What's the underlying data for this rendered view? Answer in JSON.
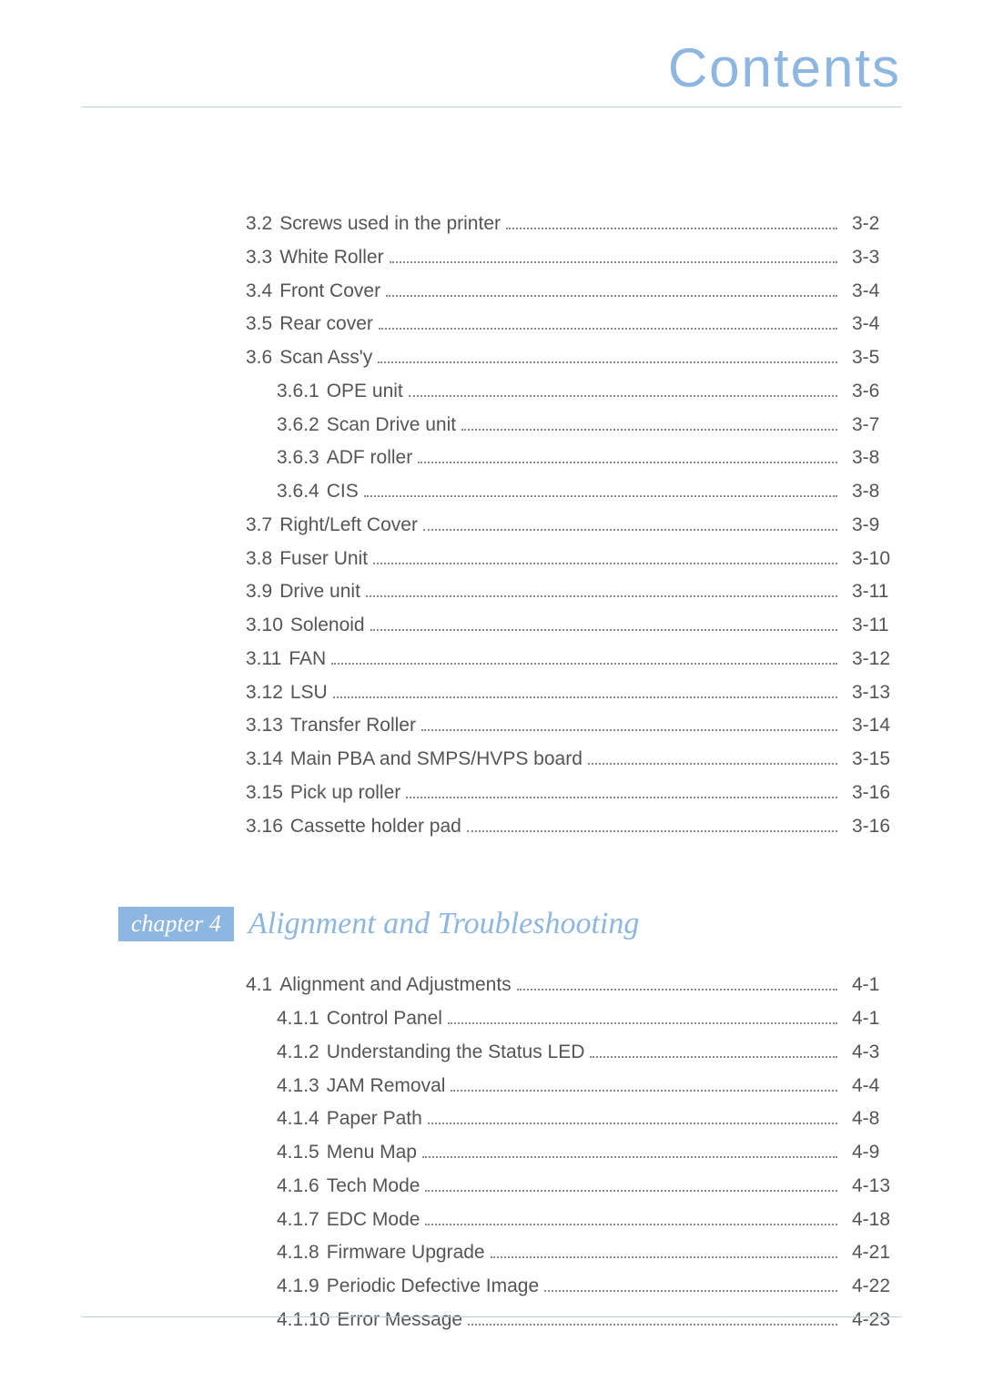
{
  "header": {
    "title": "Contents"
  },
  "section3": {
    "entries": [
      {
        "num": "3.2",
        "title": "Screws used in the printer",
        "page": "3-2",
        "indent": 0
      },
      {
        "num": "3.3",
        "title": "White Roller",
        "page": "3-3",
        "indent": 0
      },
      {
        "num": "3.4",
        "title": "Front Cover",
        "page": "3-4",
        "indent": 0
      },
      {
        "num": "3.5",
        "title": "Rear cover",
        "page": "3-4",
        "indent": 0
      },
      {
        "num": "3.6",
        "title": "Scan Ass'y",
        "page": "3-5",
        "indent": 0
      },
      {
        "num": "3.6.1",
        "title": "OPE unit",
        "page": "3-6",
        "indent": 1
      },
      {
        "num": "3.6.2",
        "title": "Scan Drive unit",
        "page": "3-7",
        "indent": 1
      },
      {
        "num": "3.6.3",
        "title": "ADF roller",
        "page": "3-8",
        "indent": 1
      },
      {
        "num": "3.6.4",
        "title": "CIS",
        "page": "3-8",
        "indent": 1
      },
      {
        "num": "3.7",
        "title": "Right/Left Cover",
        "page": "3-9",
        "indent": 0
      },
      {
        "num": "3.8",
        "title": "Fuser Unit",
        "page": "3-10",
        "indent": 0
      },
      {
        "num": "3.9",
        "title": "Drive unit",
        "page": "3-11",
        "indent": 0
      },
      {
        "num": "3.10",
        "title": "Solenoid",
        "page": "3-11",
        "indent": 0
      },
      {
        "num": "3.11",
        "title": "FAN",
        "page": "3-12",
        "indent": 0
      },
      {
        "num": "3.12",
        "title": "LSU",
        "page": "3-13",
        "indent": 0
      },
      {
        "num": "3.13",
        "title": "Transfer Roller",
        "page": "3-14",
        "indent": 0
      },
      {
        "num": "3.14",
        "title": "Main PBA and SMPS/HVPS board",
        "page": "3-15",
        "indent": 0
      },
      {
        "num": "3.15",
        "title": "Pick up roller",
        "page": "3-16",
        "indent": 0
      },
      {
        "num": "3.16",
        "title": "Cassette holder pad",
        "page": "3-16",
        "indent": 0
      }
    ]
  },
  "chapter4": {
    "badge": "chapter 4",
    "title": "Alignment and Troubleshooting",
    "entries": [
      {
        "num": "4.1",
        "title": "Alignment and Adjustments",
        "page": "4-1",
        "indent": 0
      },
      {
        "num": "4.1.1",
        "title": "Control Panel",
        "page": "4-1",
        "indent": 1
      },
      {
        "num": "4.1.2",
        "title": "Understanding the Status LED",
        "page": "4-3",
        "indent": 1
      },
      {
        "num": "4.1.3",
        "title": "JAM Removal",
        "page": "4-4",
        "indent": 1
      },
      {
        "num": "4.1.4",
        "title": "Paper Path",
        "page": "4-8",
        "indent": 1
      },
      {
        "num": "4.1.5",
        "title": "Menu Map",
        "page": "4-9",
        "indent": 1
      },
      {
        "num": "4.1.6",
        "title": "Tech Mode",
        "page": "4-13",
        "indent": 1
      },
      {
        "num": "4.1.7",
        "title": "EDC Mode",
        "page": "4-18",
        "indent": 1
      },
      {
        "num": "4.1.8",
        "title": "Firmware Upgrade",
        "page": "4-21",
        "indent": 1
      },
      {
        "num": "4.1.9",
        "title": "Periodic Defective Image",
        "page": "4-22",
        "indent": 1
      },
      {
        "num": "4.1.10",
        "title": "Error Message",
        "page": "4-23",
        "indent": 1
      }
    ]
  }
}
